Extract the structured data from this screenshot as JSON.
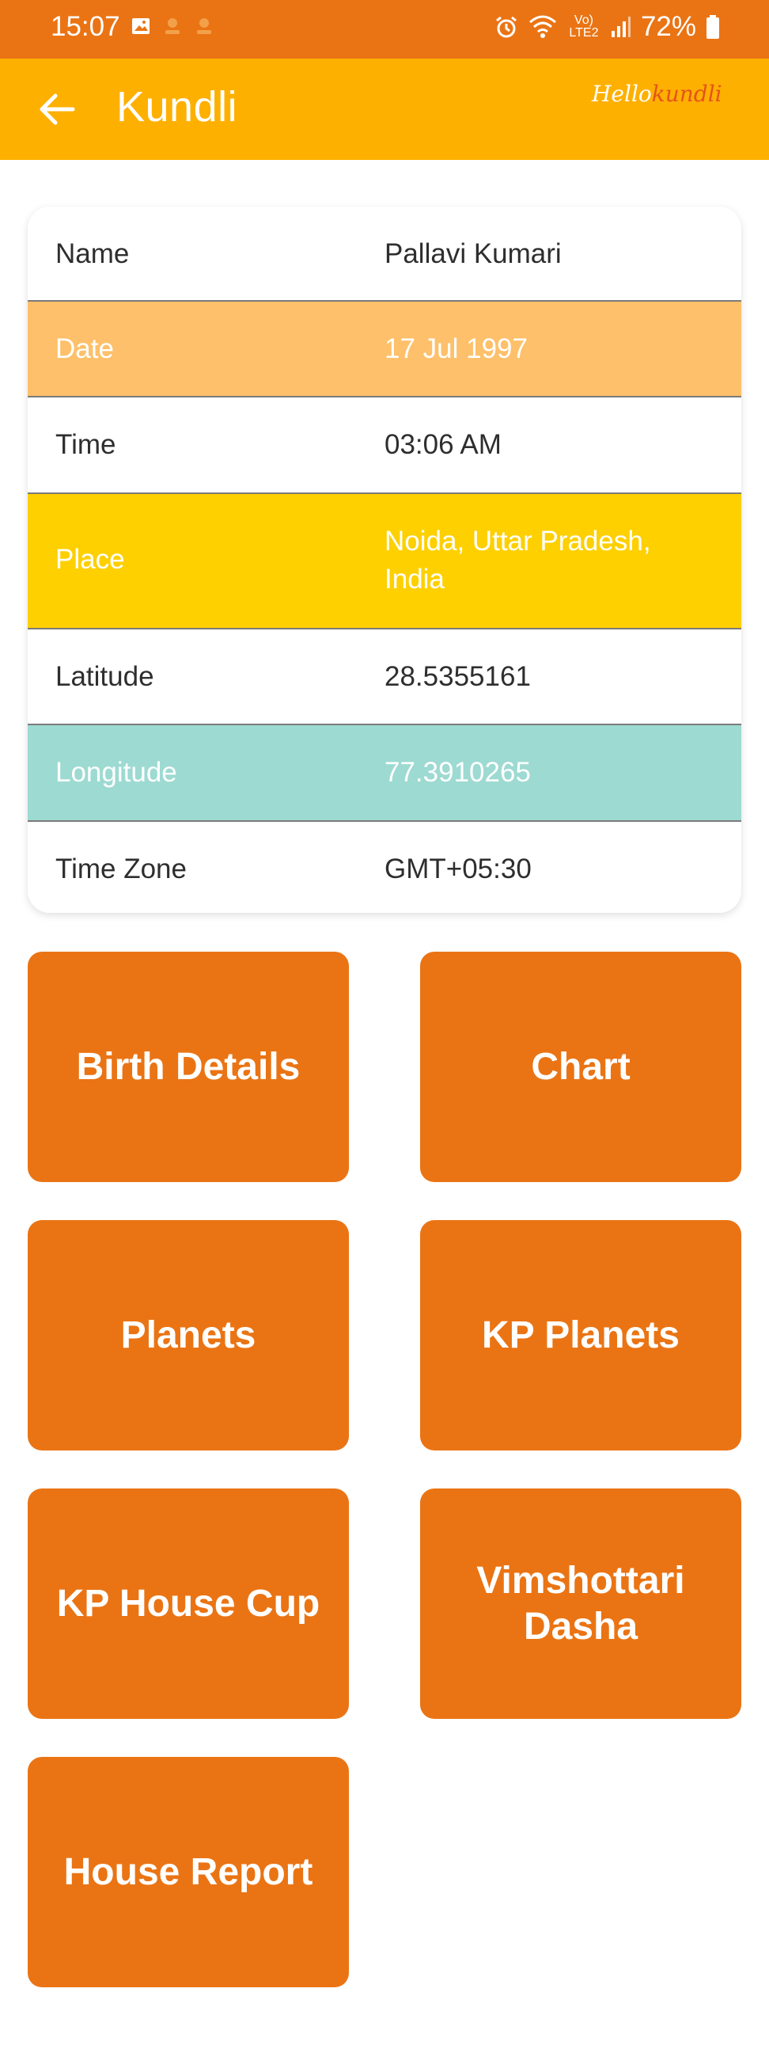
{
  "status_bar": {
    "time": "15:07",
    "battery": "72%",
    "network": "Vo) LTE2"
  },
  "app_bar": {
    "title": "Kundli",
    "logo_part1": "Hello",
    "logo_part2": "kundli"
  },
  "details": [
    {
      "label": "Name",
      "value": "Pallavi  Kumari"
    },
    {
      "label": "Date",
      "value": "17 Jul 1997"
    },
    {
      "label": "Time",
      "value": "03:06 AM"
    },
    {
      "label": "Place",
      "value": "Noida, Uttar Pradesh, India"
    },
    {
      "label": "Latitude",
      "value": "28.5355161"
    },
    {
      "label": "Longitude",
      "value": "77.3910265"
    },
    {
      "label": "Time Zone",
      "value": "GMT+05:30"
    }
  ],
  "row_colors": {
    "white": "#ffffff",
    "peach": "#fec06a",
    "yellow": "#fed000",
    "teal": "#9ddad2"
  },
  "accent_colors": {
    "status_bar": "#ea7414",
    "app_bar": "#feb000",
    "tile": "#ea7414"
  },
  "menu": {
    "birth_details": "Birth Details",
    "chart": "Chart",
    "planets": "Planets",
    "kp_planets": "KP Planets",
    "kp_house_cup": "KP House Cup",
    "vimshottari_dasha": "Vimshottari Dasha",
    "house_report": "House Report"
  }
}
